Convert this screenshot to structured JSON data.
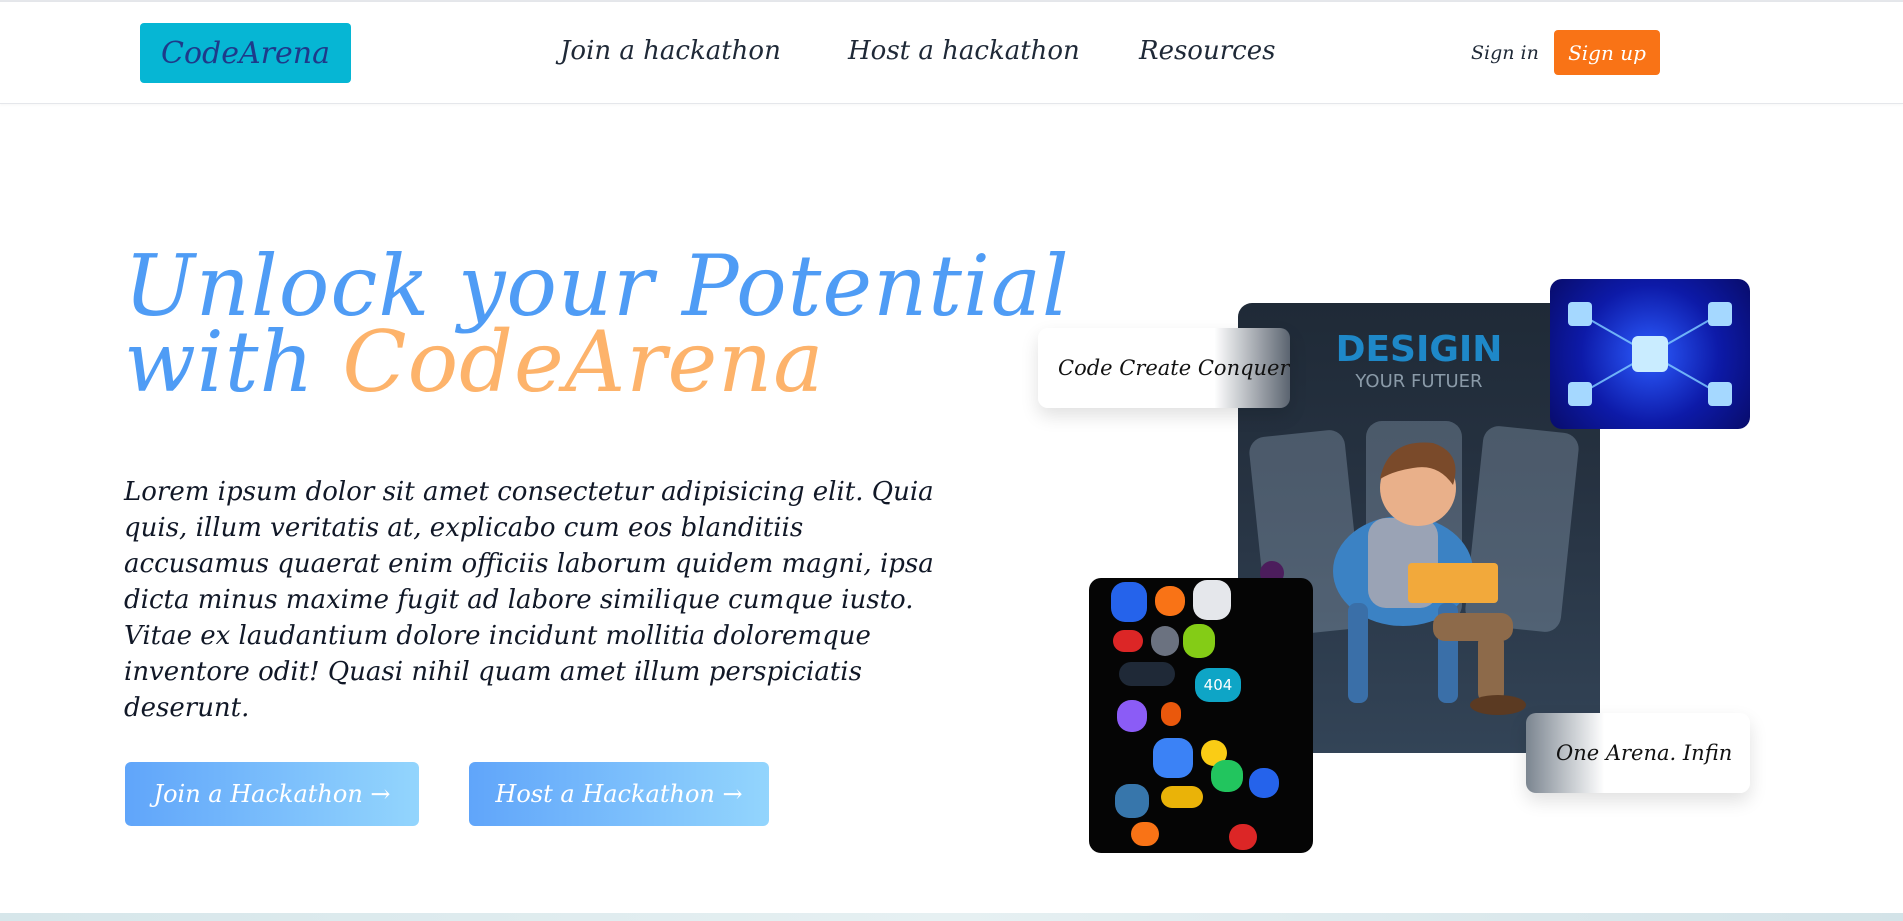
{
  "header": {
    "logo": "CodeArena",
    "nav": [
      "Join a hackathon",
      "Host a hackathon",
      "Resources"
    ],
    "signin": "Sign in",
    "signup": "Sign up"
  },
  "hero": {
    "title_line1": "Unlock your Potential",
    "title_line2_prefix": "with ",
    "title_brand": "CodeArena",
    "description": "Lorem ipsum dolor sit amet consectetur adipisicing elit. Quia quis, illum veritatis at, explicabo cum eos blanditiis accusamus quaerat enim officiis laborum quidem magni, ipsa dicta minus maxime fugit ad labore similique cumque iusto. Vitae ex laudantium dolore incidunt mollitia doloremque inventore odit! Quasi nihil quam amet illum perspiciatis deserunt.",
    "cta_join": "Join a Hackathon →",
    "cta_host": "Host a Hackathon →"
  },
  "collage": {
    "main_title": "DESIGIN",
    "main_subtitle": "YOUR FUTUER",
    "chip_1": "Code Create Conquer",
    "chip_2": "One Arena. Infin",
    "icon_404": "404"
  },
  "colors": {
    "logo_bg": "#06b6d4",
    "signup_bg": "#f97316",
    "title_blue": "#4f9cf5",
    "brand_orange": "#fdb36b"
  }
}
